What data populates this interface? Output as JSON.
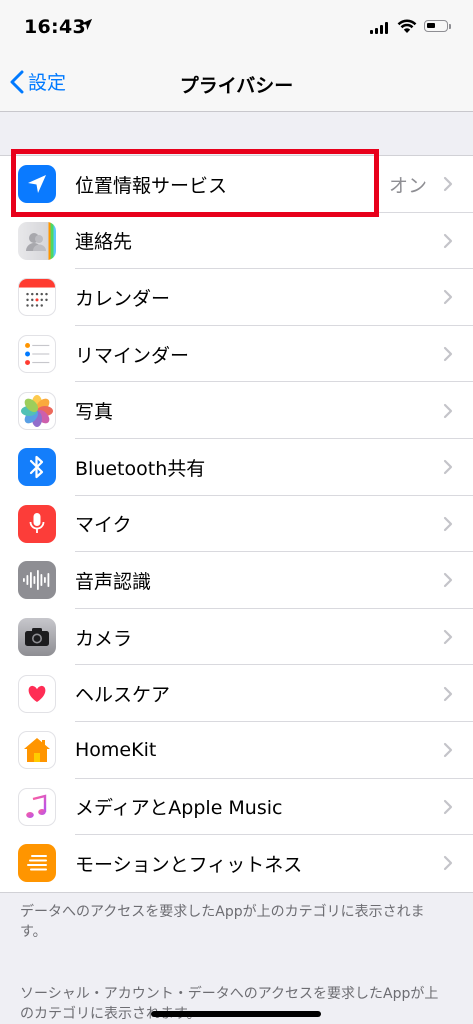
{
  "status_bar": {
    "time": "16:43"
  },
  "nav": {
    "back_label": "設定",
    "title": "プライバシー"
  },
  "rows": [
    {
      "label": "位置情報サービス",
      "value": "オン",
      "icon": "location-arrow-icon"
    },
    {
      "label": "連絡先",
      "value": "",
      "icon": "contacts-icon"
    },
    {
      "label": "カレンダー",
      "value": "",
      "icon": "calendar-icon"
    },
    {
      "label": "リマインダー",
      "value": "",
      "icon": "reminders-icon"
    },
    {
      "label": "写真",
      "value": "",
      "icon": "photos-icon"
    },
    {
      "label": "Bluetooth共有",
      "value": "",
      "icon": "bluetooth-icon"
    },
    {
      "label": "マイク",
      "value": "",
      "icon": "microphone-icon"
    },
    {
      "label": "音声認識",
      "value": "",
      "icon": "speech-recognition-icon"
    },
    {
      "label": "カメラ",
      "value": "",
      "icon": "camera-icon"
    },
    {
      "label": "ヘルスケア",
      "value": "",
      "icon": "health-heart-icon"
    },
    {
      "label": "HomeKit",
      "value": "",
      "icon": "home-icon"
    },
    {
      "label": "メディアとApple Music",
      "value": "",
      "icon": "music-note-icon"
    },
    {
      "label": "モーションとフィットネス",
      "value": "",
      "icon": "motion-fitness-icon"
    }
  ],
  "footer": {
    "note1": "データへのアクセスを要求したAppが上のカテゴリに表示されます。",
    "note2": "ソーシャル・アカウント・データへのアクセスを要求したAppが上のカテゴリに表示されます。"
  },
  "colors": {
    "accent": "#007aff",
    "highlight": "#e8001b",
    "background": "#efeff4"
  }
}
